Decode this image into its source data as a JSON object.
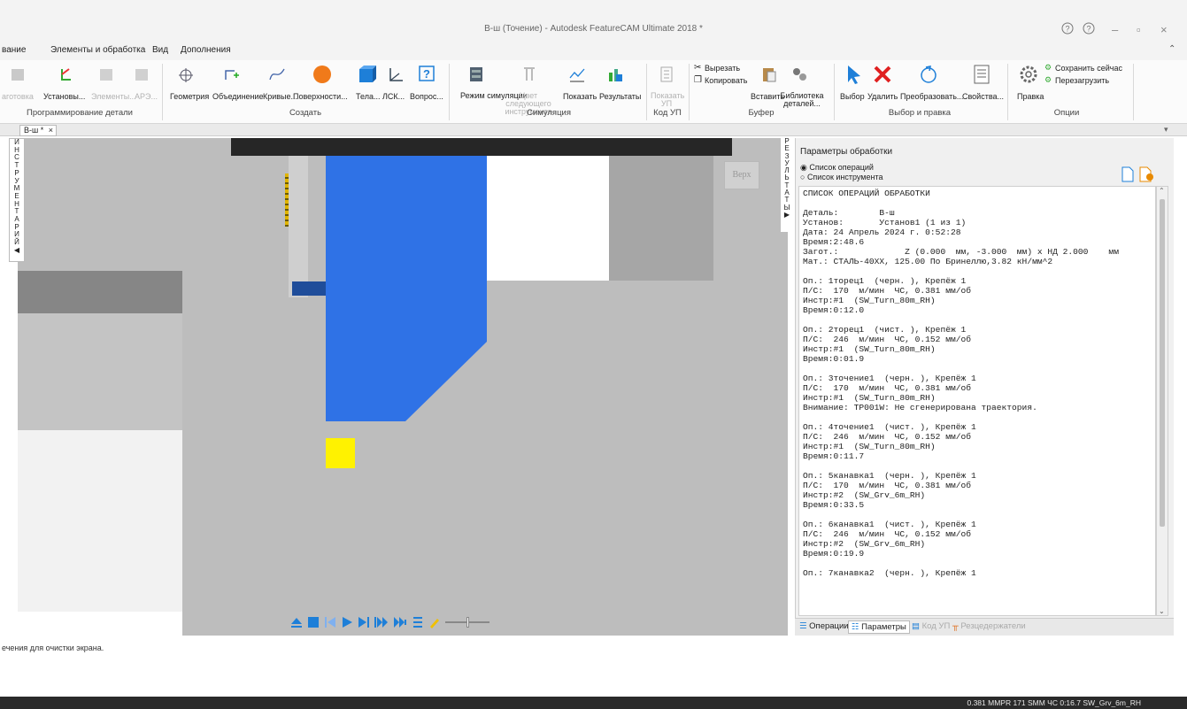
{
  "window": {
    "title": "В-ш (Точение) - Autodesk FeatureCAM Ultimate 2018 *",
    "minimize": "–",
    "restore": "▫",
    "close": "×"
  },
  "menu": [
    "вание",
    "Элементы и обработка",
    "Вид",
    "Дополнения"
  ],
  "ribbon": {
    "part_programming": {
      "label": "Программирование детали",
      "items": [
        "аготовка",
        "Установы...",
        "Элементы...",
        "АРЭ..."
      ]
    },
    "create": {
      "label": "Создать",
      "items": [
        "Геометрия",
        "Объединение",
        "Кривые...",
        "Поверхности...",
        "Тела...",
        "ЛСК...",
        "Вопрос..."
      ]
    },
    "simulation": {
      "label": "Симуляция",
      "items": [
        "Режим симуляции",
        "Цвет следующего инструмента",
        "Показать",
        "Результаты"
      ]
    },
    "nc_code": {
      "label": "Код УП",
      "items": [
        "Показать УП"
      ]
    },
    "clipboard": {
      "label": "Буфер",
      "items": [
        "Вырезать",
        "Копировать",
        "Вставить",
        "Библиотека деталей..."
      ]
    },
    "select_edit": {
      "label": "Выбор и правка",
      "items": [
        "Выбор",
        "Удалить",
        "Преобразовать...",
        "Свойства..."
      ]
    },
    "options": {
      "label": "Опции",
      "items": [
        "Правка",
        "Сохранить сейчас",
        "Перезагрузить"
      ]
    }
  },
  "doc_tab": "В-ш *",
  "left_vtab": "ИНСТРУМЕНТАРИЙ",
  "right_vtab": "РЕЗУЛЬТАТЫ",
  "viewport": {
    "view_button": "Верх"
  },
  "panel": {
    "title": "Параметры обработки",
    "radio_ops": "Список операций",
    "radio_tools": "Список инструмента",
    "listing": [
      "СПИСОК ОПЕРАЦИЙ ОБРАБОТКИ",
      "",
      "Деталь:        В-ш",
      "Установ:       Установ1 (1 из 1)",
      "Дата: 24 Апрель 2024 г. 0:52:28",
      "Время:2:48.6",
      "Загот.:             Z (0.000  мм, -3.000  мм) х НД 2.000    мм",
      "Мат.: СТАЛЬ-40ХХ, 125.00 По Бринеллю,3.82 кН/мм^2",
      "",
      "Оп.: 1торец1  (черн. ), Крепёж 1",
      "П/С:  170  м/мин  ЧС, 0.381 мм/об",
      "Инстр:#1  (SW_Turn_80m_RH)",
      "Время:0:12.0",
      "",
      "Оп.: 2торец1  (чист. ), Крепёж 1",
      "П/С:  246  м/мин  ЧС, 0.152 мм/об",
      "Инстр:#1  (SW_Turn_80m_RH)",
      "Время:0:01.9",
      "",
      "Оп.: 3точение1  (черн. ), Крепёж 1",
      "П/С:  170  м/мин  ЧС, 0.381 мм/об",
      "Инстр:#1  (SW_Turn_80m_RH)",
      "Внимание: TP001W: Не сгенерирована траектория.",
      "",
      "Оп.: 4точение1  (чист. ), Крепёж 1",
      "П/С:  246  м/мин  ЧС, 0.152 мм/об",
      "Инстр:#1  (SW_Turn_80m_RH)",
      "Время:0:11.7",
      "",
      "Оп.: 5канавка1  (черн. ), Крепёж 1",
      "П/С:  170  м/мин  ЧС, 0.381 мм/об",
      "Инстр:#2  (SW_Grv_6m_RH)",
      "Время:0:33.5",
      "",
      "Оп.: 6канавка1  (чист. ), Крепёж 1",
      "П/С:  246  м/мин  ЧС, 0.152 мм/об",
      "Инстр:#2  (SW_Grv_6m_RH)",
      "Время:0:19.9",
      "",
      "Оп.: 7канавка2  (черн. ), Крепёж 1"
    ],
    "tabs": [
      "Операции",
      "Параметры",
      "Код УП",
      "Резцедержатели"
    ],
    "active_tab": "Параметры"
  },
  "status_line": "ечения для очистки экрана.",
  "status_bar": "0.381 MMPR   171 SMM  ЧС    0:16.7   SW_Grv_6m_RH",
  "colors": {
    "tool_blue": "#2f72e6",
    "insert_yellow": "#fff200",
    "red_x": "#e02020",
    "viewport_gray": "#bdbdbd"
  }
}
